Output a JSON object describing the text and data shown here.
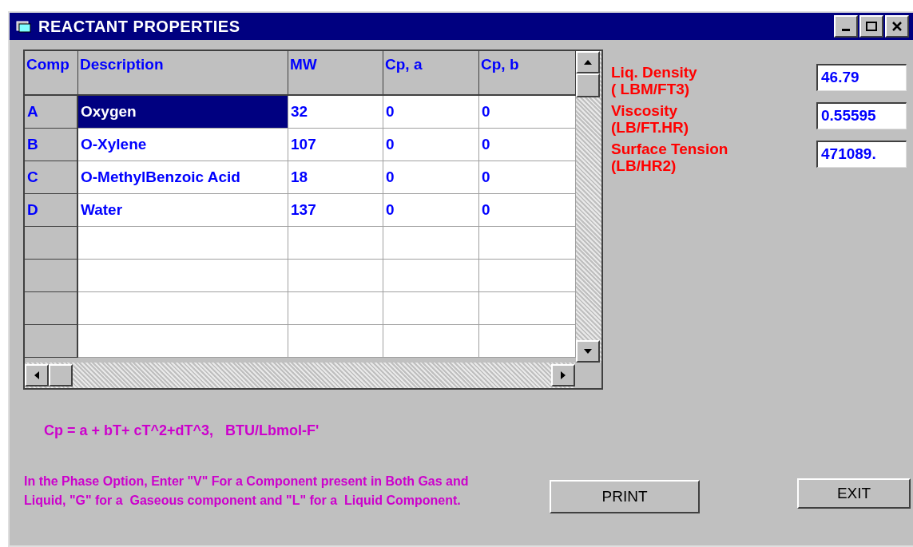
{
  "window": {
    "title": "REACTANT PROPERTIES"
  },
  "table": {
    "columns": [
      "Comp",
      "Description",
      "MW",
      "Cp, a",
      "Cp, b"
    ],
    "rows": [
      {
        "comp": "A",
        "description": "Oxygen",
        "mw": "32",
        "cp_a": "0",
        "cp_b": "0",
        "selected": true
      },
      {
        "comp": "B",
        "description": "O-Xylene",
        "mw": "107",
        "cp_a": "0",
        "cp_b": "0",
        "selected": false
      },
      {
        "comp": "C",
        "description": "O-MethylBenzoic Acid",
        "mw": "18",
        "cp_a": "0",
        "cp_b": "0",
        "selected": false
      },
      {
        "comp": "D",
        "description": "Water",
        "mw": "137",
        "cp_a": "0",
        "cp_b": "0",
        "selected": false
      }
    ]
  },
  "properties": [
    {
      "label": "Liq. Density",
      "unit": "( LBM/FT3)",
      "value": "46.79"
    },
    {
      "label": "Viscosity",
      "unit": "(LB/FT.HR)",
      "value": "0.55595"
    },
    {
      "label": "Surface Tension",
      "unit": "(LB/HR2)",
      "value": "471089."
    }
  ],
  "formula": "Cp = a + bT+ cT^2+dT^3,   BTU/Lbmol-F'",
  "note": "In the Phase Option, Enter \"V\" For a Component present in Both Gas and Liquid, \"G\" for a  Gaseous component and \"L\" for a  Liquid Component.",
  "buttons": [
    "PRINT",
    "EXIT"
  ]
}
